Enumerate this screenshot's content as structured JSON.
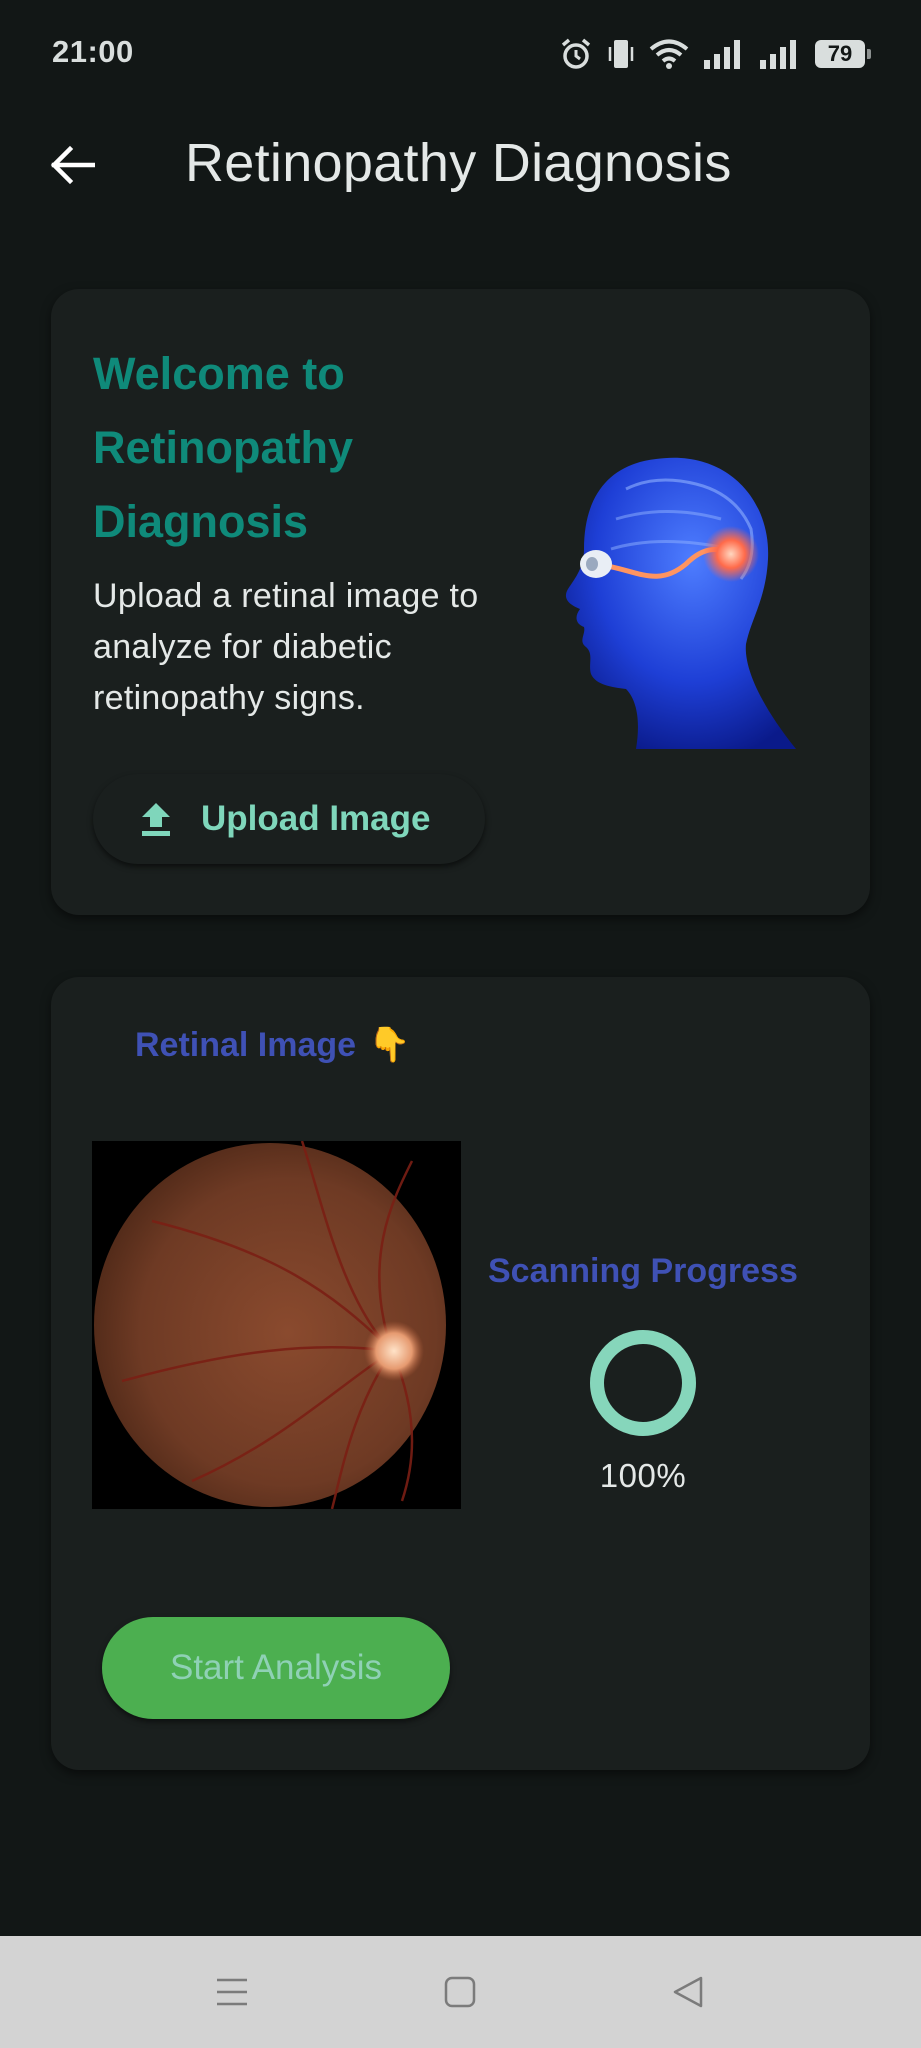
{
  "status_bar": {
    "time": "21:00",
    "battery": "79",
    "icons": [
      "alarm-icon",
      "vibrate-icon",
      "wifi-icon",
      "signal-icon",
      "signal-icon",
      "battery-icon"
    ]
  },
  "app_bar": {
    "back_icon": "arrow-left-icon",
    "title": "Retinopathy Diagnosis"
  },
  "welcome_card": {
    "title": "Welcome to Retinopathy Diagnosis",
    "description": "Upload a retinal image to analyze for diabetic retinopathy signs.",
    "upload_button": {
      "icon": "upload-icon",
      "label": "Upload Image"
    }
  },
  "image_card": {
    "heading": "Retinal Image",
    "heading_emoji": "👇",
    "progress_heading": "Scanning Progress",
    "progress_percent": 100,
    "progress_label": "100%",
    "start_button_label": "Start Analysis"
  },
  "nav_bar": {
    "icons": [
      "menu-icon",
      "home-icon",
      "back-triangle-icon"
    ]
  },
  "colors": {
    "background": "#121716",
    "card": "#1a1f1e",
    "teal_title": "#0f8a7a",
    "mint": "#7fd6bb",
    "indigo": "#3f51b5",
    "green_button": "#4caf50",
    "progress_ring": "#86d6bb"
  }
}
